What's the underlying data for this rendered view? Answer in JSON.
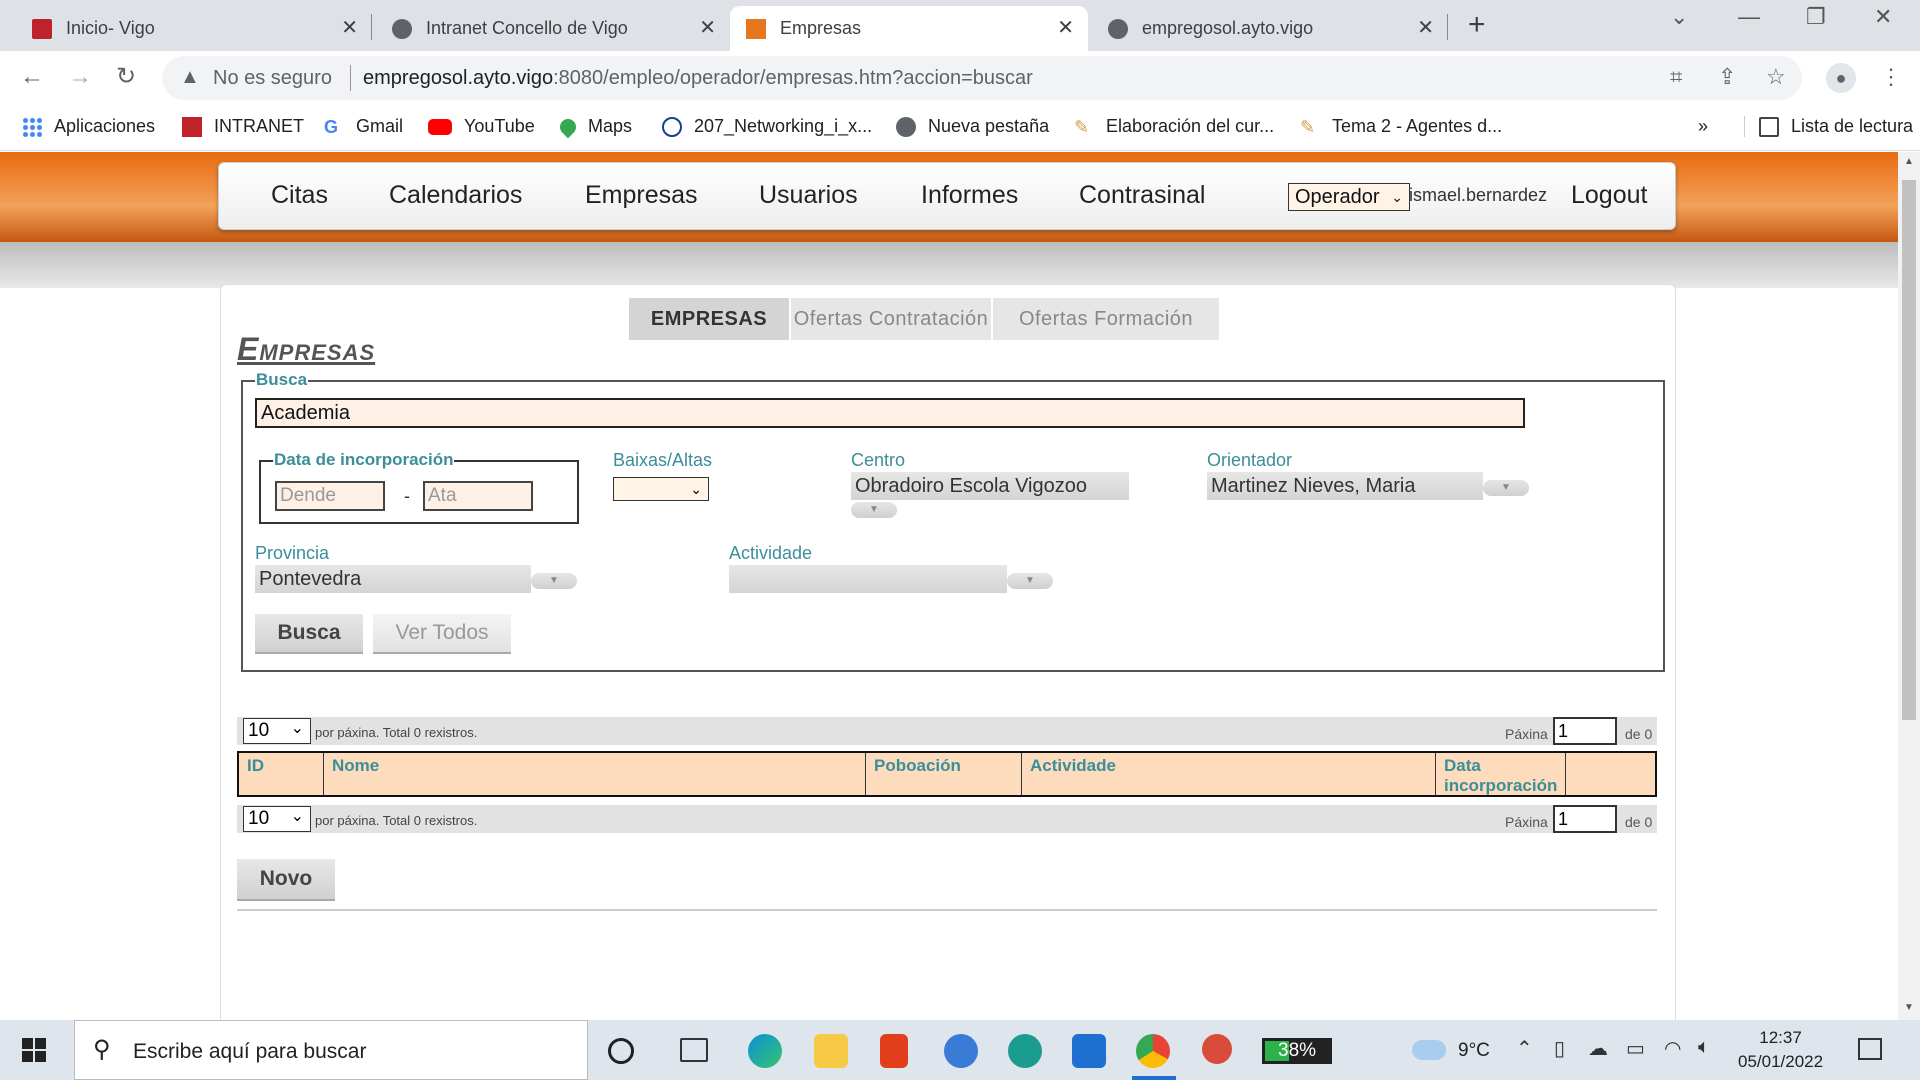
{
  "browser": {
    "tabs": [
      {
        "title": "Inicio- Vigo",
        "active": false
      },
      {
        "title": "Intranet Concello de Vigo",
        "active": false
      },
      {
        "title": "Empresas",
        "active": true
      },
      {
        "title": "empregosol.ayto.vigo",
        "active": false
      }
    ],
    "insecure_label": "No es seguro",
    "url_host": "empregosol.ayto.vigo",
    "url_rest": ":8080/empleo/operador/empresas.htm?accion=buscar",
    "bookmarks": [
      "Aplicaciones",
      "INTRANET",
      "Gmail",
      "YouTube",
      "Maps",
      "207_Networking_i_x...",
      "Nueva pestaña",
      "Elaboración del cur...",
      "Tema 2 - Agentes d..."
    ],
    "reading_list": "Lista de lectura",
    "overflow": "»"
  },
  "topnav": {
    "items": [
      "Citas",
      "Calendarios",
      "Empresas",
      "Usuarios",
      "Informes",
      "Contrasinal"
    ],
    "role": "Operador",
    "username": "ismael.bernardez",
    "logout": "Logout"
  },
  "subtabs": [
    "EMPRESAS",
    "Ofertas Contratación",
    "Ofertas Formación"
  ],
  "heading": "Empresas",
  "search": {
    "legend": "Busca",
    "value": "Academia",
    "date_legend": "Data de incorporación",
    "date_from_placeholder": "Dende",
    "date_to_placeholder": "Ata",
    "date_dash": "-",
    "baixas_label": "Baixas/Altas",
    "centro_label": "Centro",
    "centro_value": "Obradoiro Escola Vigozoo",
    "orientador_label": "Orientador",
    "orientador_value": "Martinez Nieves, Maria",
    "provincia_label": "Provincia",
    "provincia_value": "Pontevedra",
    "actividade_label": "Actividade",
    "actividade_value": "",
    "search_button": "Busca",
    "view_all_button": "Ver Todos"
  },
  "pager": {
    "per_page": "10",
    "total_text": "por páxina. Total 0 rexistros.",
    "page_label": "Páxina",
    "page_value": "1",
    "of_text": "de 0"
  },
  "grid": {
    "columns": [
      "ID",
      "Nome",
      "Poboación",
      "Actividade",
      "Data incorporación",
      ""
    ]
  },
  "novo_button": "Novo",
  "taskbar": {
    "search_placeholder": "Escribe aquí para buscar",
    "battery": "38%",
    "battery_level": 0.38,
    "temperature": "9°C",
    "time": "12:37",
    "date": "05/01/2022"
  }
}
